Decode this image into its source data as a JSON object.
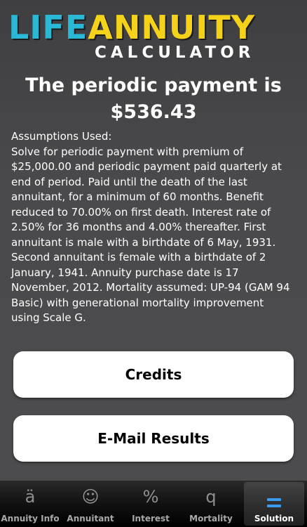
{
  "logo": {
    "life": "LIFE",
    "annuity": "ANNUITY",
    "calculator": "CALCULATOR"
  },
  "result": {
    "title": "The periodic payment is",
    "value": "$536.43"
  },
  "assumptions": {
    "heading": "Assumptions Used:",
    "text": "Solve for periodic payment with premium of $25,000.00 and periodic payment paid quarterly at end of period. Paid until the death of the last annuitant, for a minimum of 60 months. Benefit reduced to 70.00% on first death. Interest rate of 2.50% for 36 months and 4.00% thereafter. First annuitant is male with a birthdate of 6 May, 1931. Second annuitant is female with a birthdate of 2 January, 1941.  Annuity purchase date is 17 November, 2012. Mortality assumed: UP-94 (GAM 94 Basic) with generational mortality improvement using Scale G."
  },
  "buttons": {
    "credits": "Credits",
    "email": "E-Mail Results"
  },
  "tabs": [
    {
      "label": "Annuity Info",
      "icon": "ä",
      "icon_name": "a-umlaut-icon",
      "active": false
    },
    {
      "label": "Annuitant",
      "icon": "☺",
      "icon_name": "smiley-icon",
      "active": false
    },
    {
      "label": "Interest",
      "icon": "%",
      "icon_name": "percent-icon",
      "active": false
    },
    {
      "label": "Mortality",
      "icon": "q",
      "icon_name": "q-letter-icon",
      "active": false
    },
    {
      "label": "Solution",
      "icon": "=",
      "icon_name": "equals-icon",
      "active": true
    }
  ],
  "colors": {
    "logo_life": "#29b8d6",
    "logo_annuity": "#f4d21a",
    "active_tab_icon": "#3a9cf0"
  }
}
